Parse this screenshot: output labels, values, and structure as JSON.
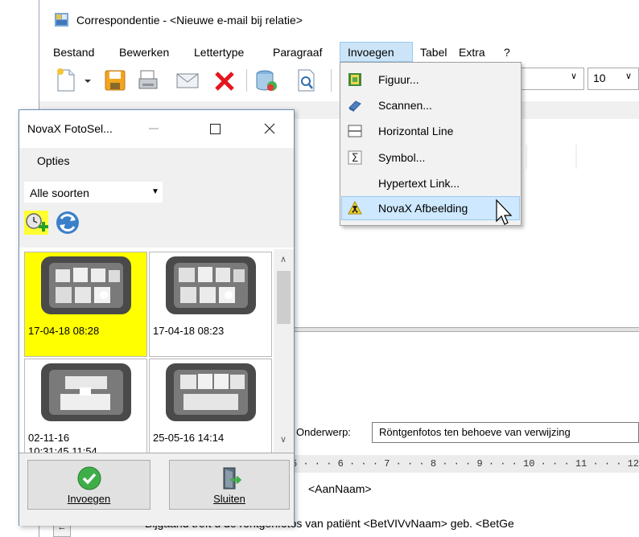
{
  "window": {
    "title": "Correspondentie - <Nieuwe e-mail bij relatie>"
  },
  "menubar": {
    "items": [
      "Bestand",
      "Bewerken",
      "Lettertype",
      "Paragraaf",
      "Invoegen",
      "Tabel",
      "Extra",
      "?"
    ],
    "active": "Invoegen"
  },
  "toolbar": {
    "font_size": "10",
    "icons": [
      "new-document-icon",
      "save-icon",
      "print-icon",
      "email-icon",
      "delete-icon",
      "database-icon",
      "print-preview-icon"
    ]
  },
  "invoegen_menu": {
    "items": [
      {
        "label": "Figuur...",
        "icon": "picture-icon"
      },
      {
        "label": "Scannen...",
        "icon": "scanner-icon"
      },
      {
        "label": "Horizontal Line",
        "icon": "horizontal-line-icon"
      },
      {
        "label": "Symbol...",
        "icon": "symbol-icon"
      },
      {
        "label": "Hypertext Link...",
        "icon": ""
      },
      {
        "label": "NovaX Afbeelding",
        "icon": "novax-radiation-icon"
      }
    ],
    "highlighted": "NovaX Afbeelding"
  },
  "email": {
    "subject_label": "Onderwerp:",
    "subject_value": "Röntgenfotos ten behoeve van verwijzing",
    "ruler": "5 · · · 6 · · · 7 · · · 8 · · · 9 · · · 10 · · · 11 · · · 12 · · ·",
    "greeting": "<AanNaam>",
    "body": "Bijgaand treft u de röntgenfotos van patiënt <BetVIVvNaam> geb. <BetGe"
  },
  "foto_selector": {
    "title": "NovaX FotoSel...",
    "menu": "Opties",
    "filter": "Alle soorten",
    "thumbnails": [
      {
        "label": "17-04-18 08:28",
        "selected": true
      },
      {
        "label": "17-04-18 08:23",
        "selected": false
      },
      {
        "label": "02-11-16",
        "label2": "10:31:45 11:54",
        "selected": false
      },
      {
        "label": "25-05-16 14:14",
        "selected": false
      }
    ],
    "buttons": {
      "insert": "Invoegen",
      "close": "Sluiten"
    }
  },
  "colors": {
    "selection_yellow": "#ffff00",
    "menu_highlight": "#cde8ff",
    "accent_blue": "#1e6fc4"
  }
}
